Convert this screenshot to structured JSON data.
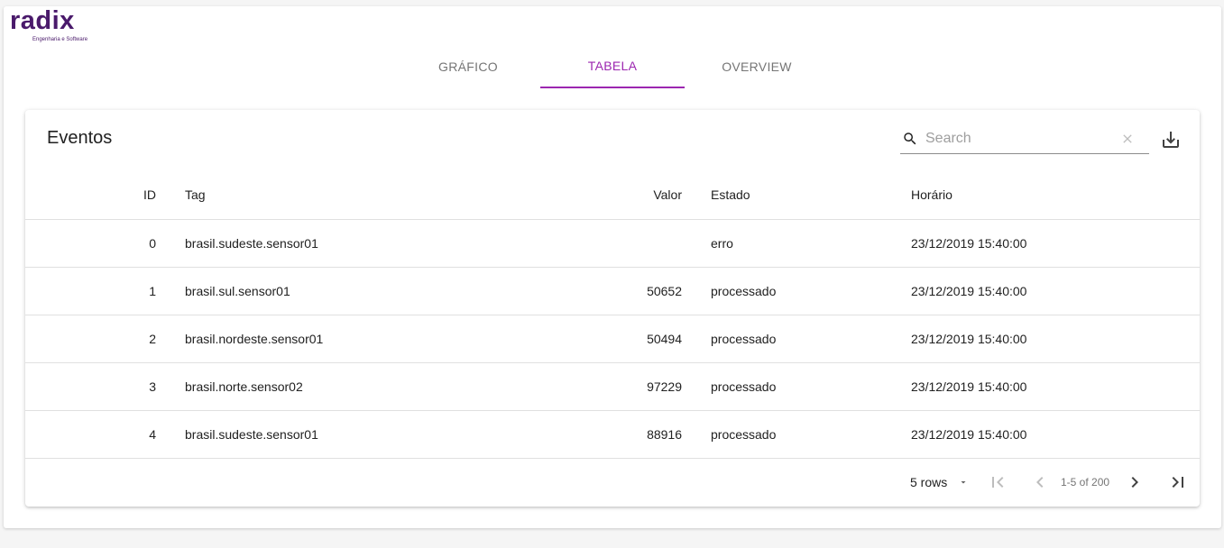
{
  "brand": {
    "name": "radix",
    "tagline": "Engenharia e Software",
    "color": "#4a1a6b"
  },
  "accent": "#9c27b0",
  "tabs": [
    {
      "label": "GRÁFICO",
      "active": false
    },
    {
      "label": "TABELA",
      "active": true
    },
    {
      "label": "OVERVIEW",
      "active": false
    }
  ],
  "card": {
    "title": "Eventos",
    "search": {
      "placeholder": "Search",
      "value": ""
    }
  },
  "table": {
    "headers": {
      "id": "ID",
      "tag": "Tag",
      "valor": "Valor",
      "estado": "Estado",
      "horario": "Horário"
    },
    "rows": [
      {
        "id": "0",
        "tag": "brasil.sudeste.sensor01",
        "valor": "",
        "estado": "erro",
        "horario": "23/12/2019 15:40:00"
      },
      {
        "id": "1",
        "tag": "brasil.sul.sensor01",
        "valor": "50652",
        "estado": "processado",
        "horario": "23/12/2019 15:40:00"
      },
      {
        "id": "2",
        "tag": "brasil.nordeste.sensor01",
        "valor": "50494",
        "estado": "processado",
        "horario": "23/12/2019 15:40:00"
      },
      {
        "id": "3",
        "tag": "brasil.norte.sensor02",
        "valor": "97229",
        "estado": "processado",
        "horario": "23/12/2019 15:40:00"
      },
      {
        "id": "4",
        "tag": "brasil.sudeste.sensor01",
        "valor": "88916",
        "estado": "processado",
        "horario": "23/12/2019 15:40:00"
      }
    ]
  },
  "pagination": {
    "rows_label": "5 rows",
    "range_label": "1-5 of 200"
  },
  "icons": [
    "search-icon",
    "clear-icon",
    "download-icon",
    "dropdown-caret-icon",
    "first-page-icon",
    "previous-page-icon",
    "next-page-icon",
    "last-page-icon"
  ]
}
